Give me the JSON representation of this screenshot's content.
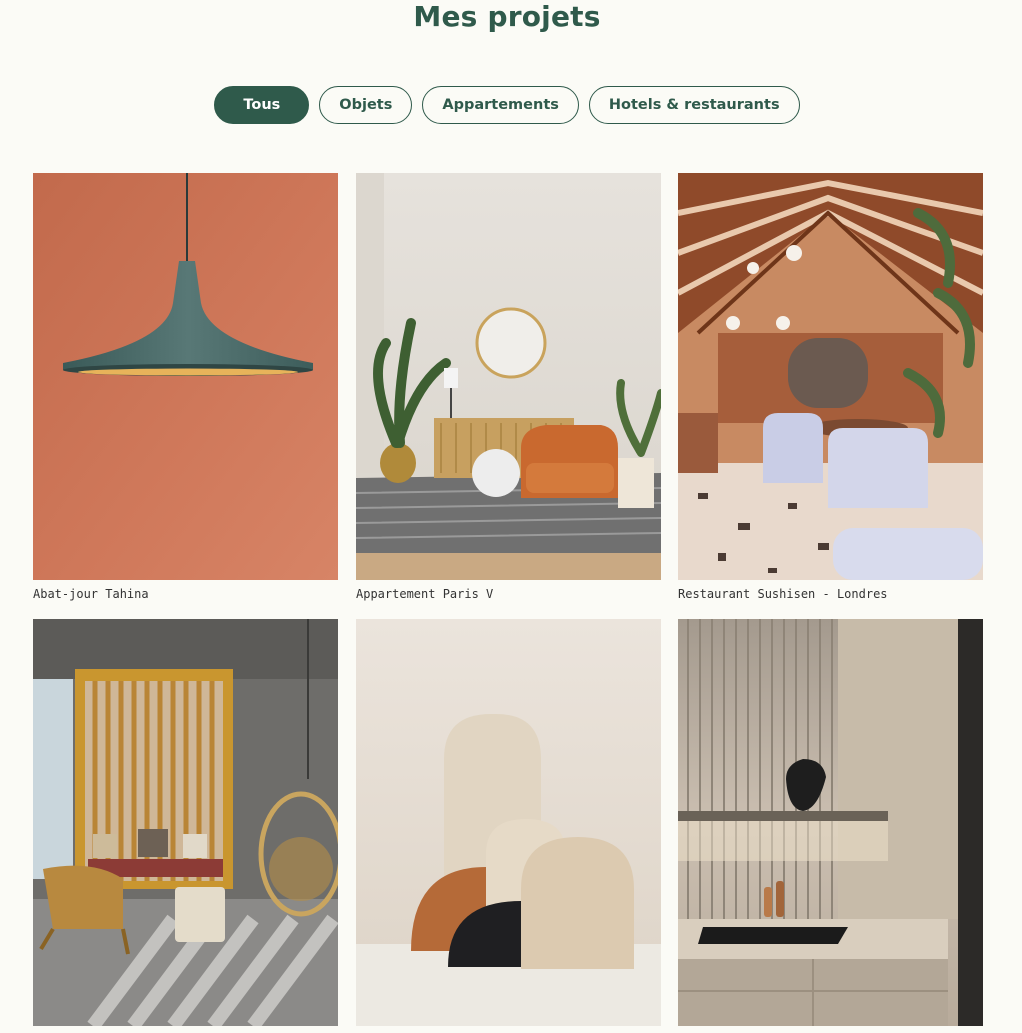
{
  "page": {
    "title": "Mes projets"
  },
  "filters": [
    {
      "label": "Tous",
      "active": true
    },
    {
      "label": "Objets",
      "active": false
    },
    {
      "label": "Appartements",
      "active": false
    },
    {
      "label": "Hotels & restaurants",
      "active": false
    }
  ],
  "projects": [
    {
      "caption": "Abat-jour Tahina",
      "image": "pendant-lamp-on-terracotta-wall"
    },
    {
      "caption": "Appartement Paris V",
      "image": "living-room-with-orange-armchair"
    },
    {
      "caption": "Restaurant Sushisen - Londres",
      "image": "restaurant-with-wooden-roof"
    },
    {
      "caption": "",
      "image": "room-with-wooden-screen-and-hanging-chair"
    },
    {
      "caption": "",
      "image": "arch-shapes-sculpture"
    },
    {
      "caption": "",
      "image": "kitchen-with-lamp-on-shelf"
    }
  ],
  "colors": {
    "accent": "#2f5a4b",
    "background": "#fbfbf6"
  }
}
